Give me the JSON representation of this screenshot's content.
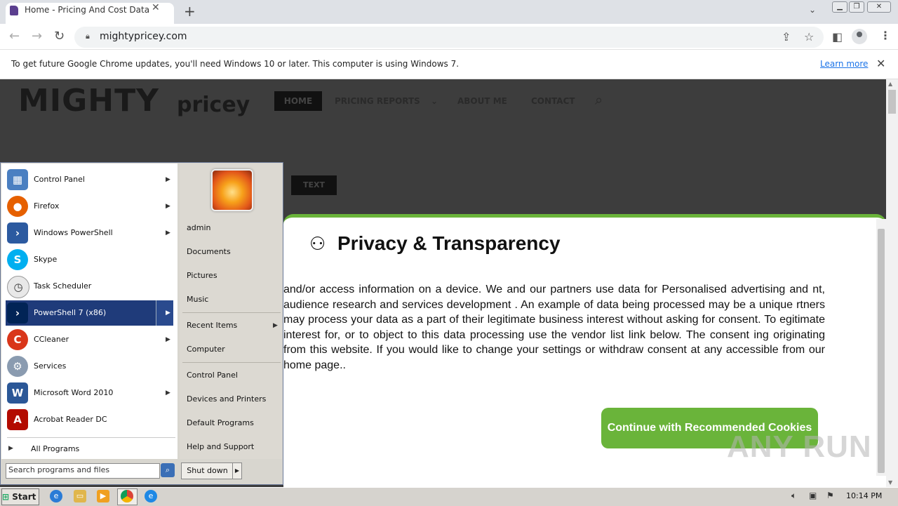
{
  "browser": {
    "tab_title": "Home - Pricing And Cost Data",
    "url": "mightypricey.com",
    "info_bar_text": "To get future Google Chrome updates, you'll need Windows 10 or later. This computer is using Windows 7.",
    "info_bar_link": "Learn more",
    "icons": [
      "back-icon",
      "forward-icon",
      "reload-icon",
      "lock-icon",
      "share-icon",
      "star-icon",
      "side-panel-icon",
      "profile-icon",
      "menu-icon"
    ]
  },
  "site": {
    "logo_main": "MIGHTY",
    "logo_sub": "pricey",
    "nav": [
      "HOME",
      "PRICING REPORTS",
      "ABOUT ME",
      "CONTACT"
    ],
    "button_text": "TEXT"
  },
  "privacy_modal": {
    "title": "Privacy & Transparency",
    "body": "and/or access information on a device. We and our partners use data for Personalised advertising and nt, audience research and services development . An example of data being processed may be a unique rtners may process your data as a part of their legitimate business interest without asking for consent. To egitimate interest for, or to object to this data processing use the vendor list link below. The consent ing originating from this website. If you would like to change your settings or withdraw consent at any accessible from our home page..",
    "continue_button": "Continue with Recommended Cookies",
    "accent_color": "#6ab43a"
  },
  "watermark": "ANY RUN",
  "start_menu": {
    "programs": [
      {
        "label": "Control Panel",
        "icon": "control-panel-icon",
        "arrow": true
      },
      {
        "label": "Firefox",
        "icon": "firefox-icon",
        "arrow": true
      },
      {
        "label": "Windows PowerShell",
        "icon": "powershell-icon",
        "arrow": true
      },
      {
        "label": "Skype",
        "icon": "skype-icon",
        "arrow": false
      },
      {
        "label": "Task Scheduler",
        "icon": "task-scheduler-icon",
        "arrow": false
      },
      {
        "label": "PowerShell 7 (x86)",
        "icon": "powershell7-icon",
        "arrow": true
      },
      {
        "label": "CCleaner",
        "icon": "ccleaner-icon",
        "arrow": true
      },
      {
        "label": "Services",
        "icon": "services-icon",
        "arrow": false
      },
      {
        "label": "Microsoft Word 2010",
        "icon": "word-icon",
        "arrow": true
      },
      {
        "label": "Acrobat Reader DC",
        "icon": "acrobat-icon",
        "arrow": false
      }
    ],
    "all_programs": "All Programs",
    "search_placeholder": "Search programs and files",
    "right_panel": {
      "user": "admin",
      "documents": "Documents",
      "pictures": "Pictures",
      "music": "Music",
      "recent_items": "Recent Items",
      "computer": "Computer",
      "control_panel": "Control Panel",
      "devices_printers": "Devices and Printers",
      "default_programs": "Default Programs",
      "help_support": "Help and Support"
    },
    "shutdown": "Shut down"
  },
  "taskbar": {
    "start": "Start",
    "clock": "10:14 PM"
  }
}
